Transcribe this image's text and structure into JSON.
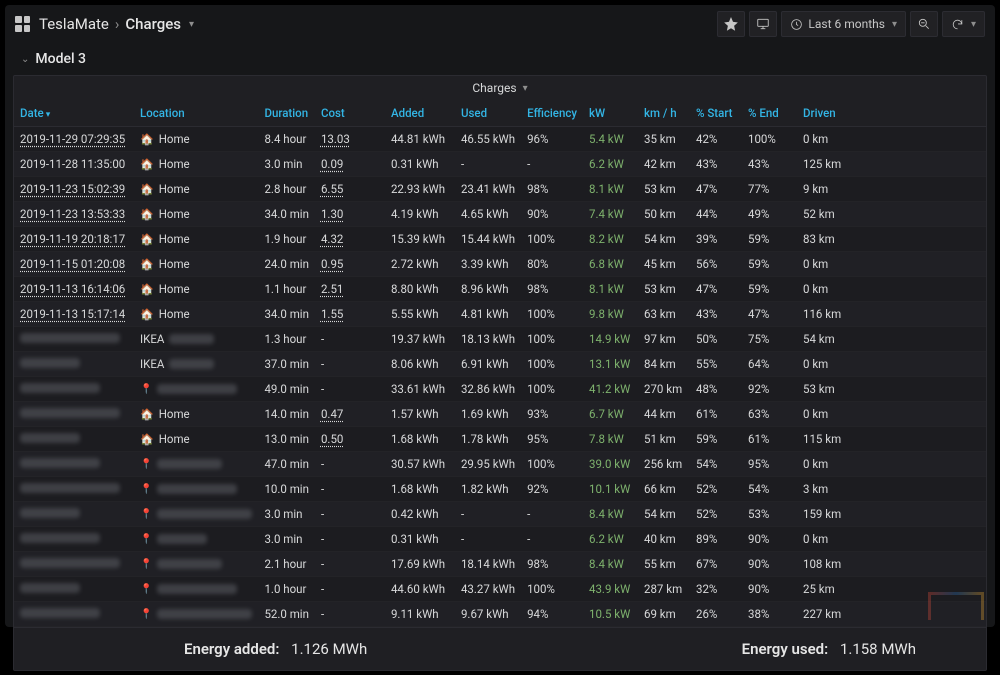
{
  "header": {
    "app": "TeslaMate",
    "page": "Charges",
    "time_range": "Last 6 months"
  },
  "section": {
    "name": "Model 3"
  },
  "panel": {
    "title": "Charges"
  },
  "columns": {
    "date": "Date",
    "location": "Location",
    "duration": "Duration",
    "cost": "Cost",
    "added": "Added",
    "used": "Used",
    "efficiency": "Efficiency",
    "kw": "kW",
    "kmh": "km / h",
    "pct_start": "% Start",
    "pct_end": "% End",
    "driven": "Driven"
  },
  "locations": {
    "home": "Home",
    "ikea": "IKEA"
  },
  "rows": [
    {
      "date": "2019-11-29 07:29:35",
      "date_link": true,
      "loc": "home",
      "dur": "8.4 hour",
      "cost": "13.03",
      "cost_u": true,
      "added": "44.81 kWh",
      "used": "46.55 kWh",
      "eff": "96%",
      "kw": "5.4 kW",
      "kmh": "35 km",
      "pst": "42%",
      "pen": "100%",
      "drv": "0 km"
    },
    {
      "date": "2019-11-28 11:35:00",
      "date_link": false,
      "loc": "home",
      "dur": "3.0 min",
      "cost": "0.09",
      "cost_u": true,
      "added": "0.31 kWh",
      "used": "-",
      "eff": "-",
      "kw": "6.2 kW",
      "kmh": "42 km",
      "pst": "43%",
      "pen": "43%",
      "drv": "125 km"
    },
    {
      "date": "2019-11-23 15:02:39",
      "date_link": true,
      "loc": "home",
      "dur": "2.8 hour",
      "cost": "6.55",
      "cost_u": true,
      "added": "22.93 kWh",
      "used": "23.41 kWh",
      "eff": "98%",
      "kw": "8.1 kW",
      "kmh": "53 km",
      "pst": "47%",
      "pen": "77%",
      "drv": "9 km"
    },
    {
      "date": "2019-11-23 13:53:33",
      "date_link": true,
      "loc": "home",
      "dur": "34.0 min",
      "cost": "1.30",
      "cost_u": true,
      "added": "4.19 kWh",
      "used": "4.65 kWh",
      "eff": "90%",
      "kw": "7.4 kW",
      "kmh": "50 km",
      "pst": "44%",
      "pen": "49%",
      "drv": "52 km"
    },
    {
      "date": "2019-11-19 20:18:17",
      "date_link": true,
      "loc": "home",
      "dur": "1.9 hour",
      "cost": "4.32",
      "cost_u": true,
      "added": "15.39 kWh",
      "used": "15.44 kWh",
      "eff": "100%",
      "kw": "8.2 kW",
      "kmh": "54 km",
      "pst": "39%",
      "pen": "59%",
      "drv": "83 km"
    },
    {
      "date": "2019-11-15 01:20:08",
      "date_link": true,
      "loc": "home",
      "dur": "24.0 min",
      "cost": "0.95",
      "cost_u": true,
      "added": "2.72 kWh",
      "used": "3.39 kWh",
      "eff": "80%",
      "kw": "6.8 kW",
      "kmh": "45 km",
      "pst": "56%",
      "pen": "59%",
      "drv": "0 km"
    },
    {
      "date": "2019-11-13 16:14:06",
      "date_link": true,
      "loc": "home",
      "dur": "1.1 hour",
      "cost": "2.51",
      "cost_u": true,
      "added": "8.80 kWh",
      "used": "8.96 kWh",
      "eff": "98%",
      "kw": "8.1 kW",
      "kmh": "53 km",
      "pst": "47%",
      "pen": "59%",
      "drv": "0 km"
    },
    {
      "date": "2019-11-13 15:17:14",
      "date_link": true,
      "loc": "home",
      "dur": "34.0 min",
      "cost": "1.55",
      "cost_u": true,
      "added": "5.55 kWh",
      "used": "4.81 kWh",
      "eff": "100%",
      "kw": "9.8 kW",
      "kmh": "63 km",
      "pst": "43%",
      "pen": "47%",
      "drv": "116 km"
    },
    {
      "date": "",
      "date_link": false,
      "loc": "ikea",
      "dur": "1.3 hour",
      "cost": "-",
      "cost_u": false,
      "added": "19.37 kWh",
      "used": "18.13 kWh",
      "eff": "100%",
      "kw": "14.9 kW",
      "kmh": "97 km",
      "pst": "50%",
      "pen": "75%",
      "drv": "54 km"
    },
    {
      "date": "",
      "date_link": false,
      "loc": "ikea",
      "dur": "37.0 min",
      "cost": "-",
      "cost_u": false,
      "added": "8.06 kWh",
      "used": "6.91 kWh",
      "eff": "100%",
      "kw": "13.1 kW",
      "kmh": "84 km",
      "pst": "55%",
      "pen": "64%",
      "drv": "0 km"
    },
    {
      "date": "",
      "date_link": false,
      "loc": "pin",
      "dur": "49.0 min",
      "cost": "-",
      "cost_u": false,
      "added": "33.61 kWh",
      "used": "32.86 kWh",
      "eff": "100%",
      "kw": "41.2 kW",
      "kmh": "270 km",
      "pst": "48%",
      "pen": "92%",
      "drv": "53 km"
    },
    {
      "date": "",
      "date_link": false,
      "loc": "home",
      "dur": "14.0 min",
      "cost": "0.47",
      "cost_u": true,
      "added": "1.57 kWh",
      "used": "1.69 kWh",
      "eff": "93%",
      "kw": "6.7 kW",
      "kmh": "44 km",
      "pst": "61%",
      "pen": "63%",
      "drv": "0 km"
    },
    {
      "date": "",
      "date_link": false,
      "loc": "home",
      "dur": "13.0 min",
      "cost": "0.50",
      "cost_u": true,
      "added": "1.68 kWh",
      "used": "1.78 kWh",
      "eff": "95%",
      "kw": "7.8 kW",
      "kmh": "51 km",
      "pst": "59%",
      "pen": "61%",
      "drv": "115 km"
    },
    {
      "date": "",
      "date_link": false,
      "loc": "pin",
      "dur": "47.0 min",
      "cost": "-",
      "cost_u": false,
      "added": "30.57 kWh",
      "used": "29.95 kWh",
      "eff": "100%",
      "kw": "39.0 kW",
      "kmh": "256 km",
      "pst": "54%",
      "pen": "95%",
      "drv": "0 km"
    },
    {
      "date": "",
      "date_link": false,
      "loc": "pin",
      "dur": "10.0 min",
      "cost": "-",
      "cost_u": false,
      "added": "1.68 kWh",
      "used": "1.82 kWh",
      "eff": "92%",
      "kw": "10.1 kW",
      "kmh": "66 km",
      "pst": "52%",
      "pen": "54%",
      "drv": "3 km"
    },
    {
      "date": "",
      "date_link": false,
      "loc": "pin",
      "dur": "3.0 min",
      "cost": "-",
      "cost_u": false,
      "added": "0.42 kWh",
      "used": "-",
      "eff": "-",
      "kw": "8.4 kW",
      "kmh": "54 km",
      "pst": "52%",
      "pen": "53%",
      "drv": "159 km"
    },
    {
      "date": "",
      "date_link": false,
      "loc": "pin",
      "dur": "3.0 min",
      "cost": "-",
      "cost_u": false,
      "added": "0.31 kWh",
      "used": "-",
      "eff": "-",
      "kw": "6.2 kW",
      "kmh": "40 km",
      "pst": "89%",
      "pen": "90%",
      "drv": "0 km"
    },
    {
      "date": "",
      "date_link": false,
      "loc": "pin",
      "dur": "2.1 hour",
      "cost": "-",
      "cost_u": false,
      "added": "17.69 kWh",
      "used": "18.14 kWh",
      "eff": "98%",
      "kw": "8.4 kW",
      "kmh": "55 km",
      "pst": "67%",
      "pen": "90%",
      "drv": "108 km"
    },
    {
      "date": "",
      "date_link": false,
      "loc": "pin",
      "dur": "1.0 hour",
      "cost": "-",
      "cost_u": false,
      "added": "44.60 kWh",
      "used": "43.27 kWh",
      "eff": "100%",
      "kw": "43.9 kW",
      "kmh": "287 km",
      "pst": "32%",
      "pen": "90%",
      "drv": "25 km"
    },
    {
      "date": "",
      "date_link": false,
      "loc": "pin",
      "dur": "52.0 min",
      "cost": "-",
      "cost_u": false,
      "added": "9.11 kWh",
      "used": "9.67 kWh",
      "eff": "94%",
      "kw": "10.5 kW",
      "kmh": "69 km",
      "pst": "26%",
      "pen": "38%",
      "drv": "227 km"
    }
  ],
  "footer": {
    "added_label": "Energy added:",
    "added_value": "1.126 MWh",
    "used_label": "Energy used:",
    "used_value": "1.158 MWh"
  }
}
